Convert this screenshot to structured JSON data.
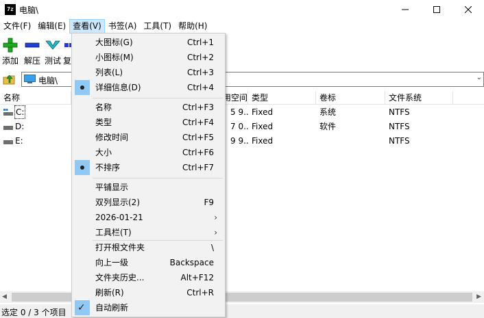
{
  "window": {
    "icon_text": "7z",
    "title": "电脑\\"
  },
  "menubar": {
    "items": [
      "文件(F)",
      "编辑(E)",
      "查看(V)",
      "书签(A)",
      "工具(T)",
      "帮助(H)"
    ]
  },
  "toolbar": {
    "add": "添加",
    "extract": "解压",
    "test": "测试",
    "copy": "复"
  },
  "address": {
    "path": "电脑\\"
  },
  "columns": {
    "name": "名称",
    "free_space": "可用空间",
    "type": "类型",
    "volume": "卷标",
    "filesystem": "文件系统"
  },
  "drives": [
    {
      "name": "C:",
      "free": "5 9...",
      "type": "Fixed",
      "volume": "系统",
      "fs": "NTFS"
    },
    {
      "name": "D:",
      "free": "7 0...",
      "type": "Fixed",
      "volume": "软件",
      "fs": "NTFS"
    },
    {
      "name": "E:",
      "free": "9 9...",
      "type": "Fixed",
      "volume": "",
      "fs": "NTFS"
    }
  ],
  "status": {
    "text": "选定 0 / 3 个项目"
  },
  "view_menu": {
    "items": [
      {
        "label": "大图标(G)",
        "shortcut": "Ctrl+1"
      },
      {
        "label": "小图标(M)",
        "shortcut": "Ctrl+2"
      },
      {
        "label": "列表(L)",
        "shortcut": "Ctrl+3"
      },
      {
        "label": "详细信息(D)",
        "shortcut": "Ctrl+4"
      },
      {
        "label": "名称",
        "shortcut": "Ctrl+F3"
      },
      {
        "label": "类型",
        "shortcut": "Ctrl+F4"
      },
      {
        "label": "修改时间",
        "shortcut": "Ctrl+F5"
      },
      {
        "label": "大小",
        "shortcut": "Ctrl+F6"
      },
      {
        "label": "不排序",
        "shortcut": "Ctrl+F7"
      },
      {
        "label": "平铺显示",
        "shortcut": ""
      },
      {
        "label": "双列显示(2)",
        "shortcut": "F9"
      },
      {
        "label": "2026-01-21",
        "shortcut": ""
      },
      {
        "label": "工具栏(T)",
        "shortcut": ""
      },
      {
        "label": "打开根文件夹",
        "shortcut": "\\"
      },
      {
        "label": "向上一级",
        "shortcut": "Backspace"
      },
      {
        "label": "文件夹历史...",
        "shortcut": "Alt+F12"
      },
      {
        "label": "刷新(R)",
        "shortcut": "Ctrl+R"
      },
      {
        "label": "自动刷新",
        "shortcut": ""
      }
    ]
  },
  "colors": {
    "menu_highlight": "#cce8ff",
    "check_mark_bg": "#90c8f6",
    "menu_bg": "#f2f2f2"
  }
}
